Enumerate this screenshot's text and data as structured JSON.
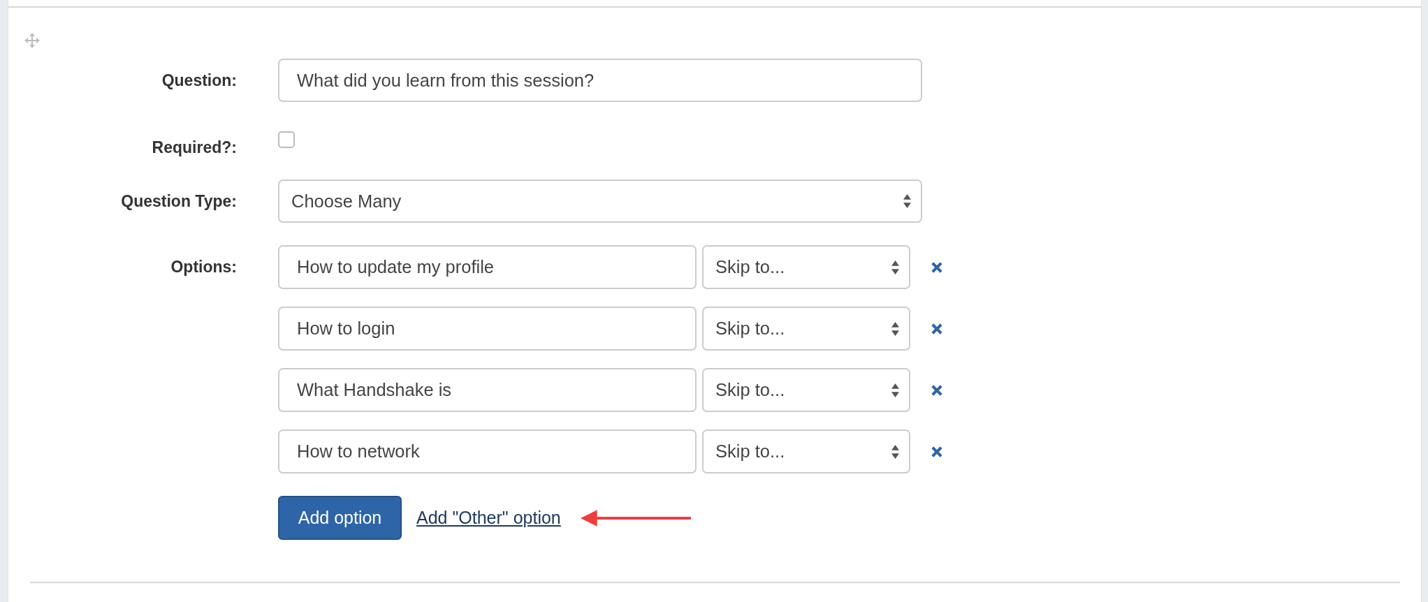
{
  "question": {
    "label": "Question:",
    "value": "What did you learn from this session?"
  },
  "required": {
    "label": "Required?:",
    "checked": false
  },
  "question_type": {
    "label": "Question Type:",
    "value": "Choose Many"
  },
  "options": {
    "label": "Options:",
    "items": [
      {
        "text": "How to update my profile",
        "skip_to": "Skip to..."
      },
      {
        "text": "How to login",
        "skip_to": "Skip to..."
      },
      {
        "text": "What Handshake is",
        "skip_to": "Skip to..."
      },
      {
        "text": "How to network",
        "skip_to": "Skip to..."
      }
    ]
  },
  "add_option_button": "Add option",
  "add_other_link": "Add \"Other\" option"
}
